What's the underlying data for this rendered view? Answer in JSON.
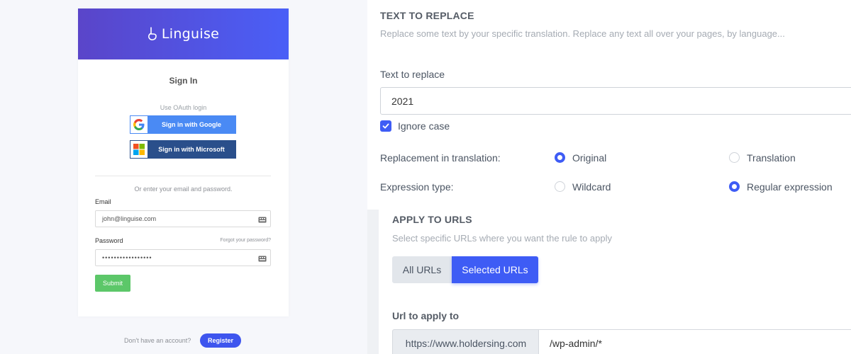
{
  "login": {
    "brand": "Linguise",
    "title": "Sign In",
    "oauth_caption": "Use OAuth login",
    "google_button": "Sign in with Google",
    "microsoft_button": "Sign in with Microsoft",
    "or_text": "Or enter your email and password.",
    "email_label": "Email",
    "email_value": "john@linguise.com",
    "password_label": "Password",
    "forgot_link": "Forgot your password?",
    "password_value": "•••••••••••••••••",
    "submit_button": "Submit",
    "footer_text": "Don't have an account?",
    "register_button": "Register",
    "colors": {
      "header_start": "#5a45c9",
      "header_end": "#4a5ff7",
      "google": "#4a8af4",
      "microsoft": "#2a4f8b",
      "submit": "#5cc769",
      "register": "#3e55ee"
    }
  },
  "replace_section": {
    "title": "TEXT TO REPLACE",
    "description": "Replace some text by your specific translation. Replace any text all over your pages, by language...",
    "text_label": "Text to replace",
    "text_value": "2021",
    "ignore_case_label": "Ignore case",
    "ignore_case_checked": true,
    "replacement_label": "Replacement in translation:",
    "replacement_options": [
      {
        "label": "Original",
        "selected": true
      },
      {
        "label": "Translation",
        "selected": false
      }
    ],
    "expression_label": "Expression type:",
    "expression_options": [
      {
        "label": "Wildcard",
        "selected": false
      },
      {
        "label": "Regular expression",
        "selected": true
      }
    ]
  },
  "urls_section": {
    "title": "APPLY TO URLS",
    "description": "Select specific URLs where you want the rule to apply",
    "segments": [
      {
        "label": "All URLs",
        "active": false
      },
      {
        "label": "Selected URLs",
        "active": true
      }
    ],
    "url_label": "Url to apply to",
    "url_prefix": "https://www.holdersing.com",
    "url_value": "/wp-admin/*",
    "accent_color": "#3e5cf5"
  }
}
